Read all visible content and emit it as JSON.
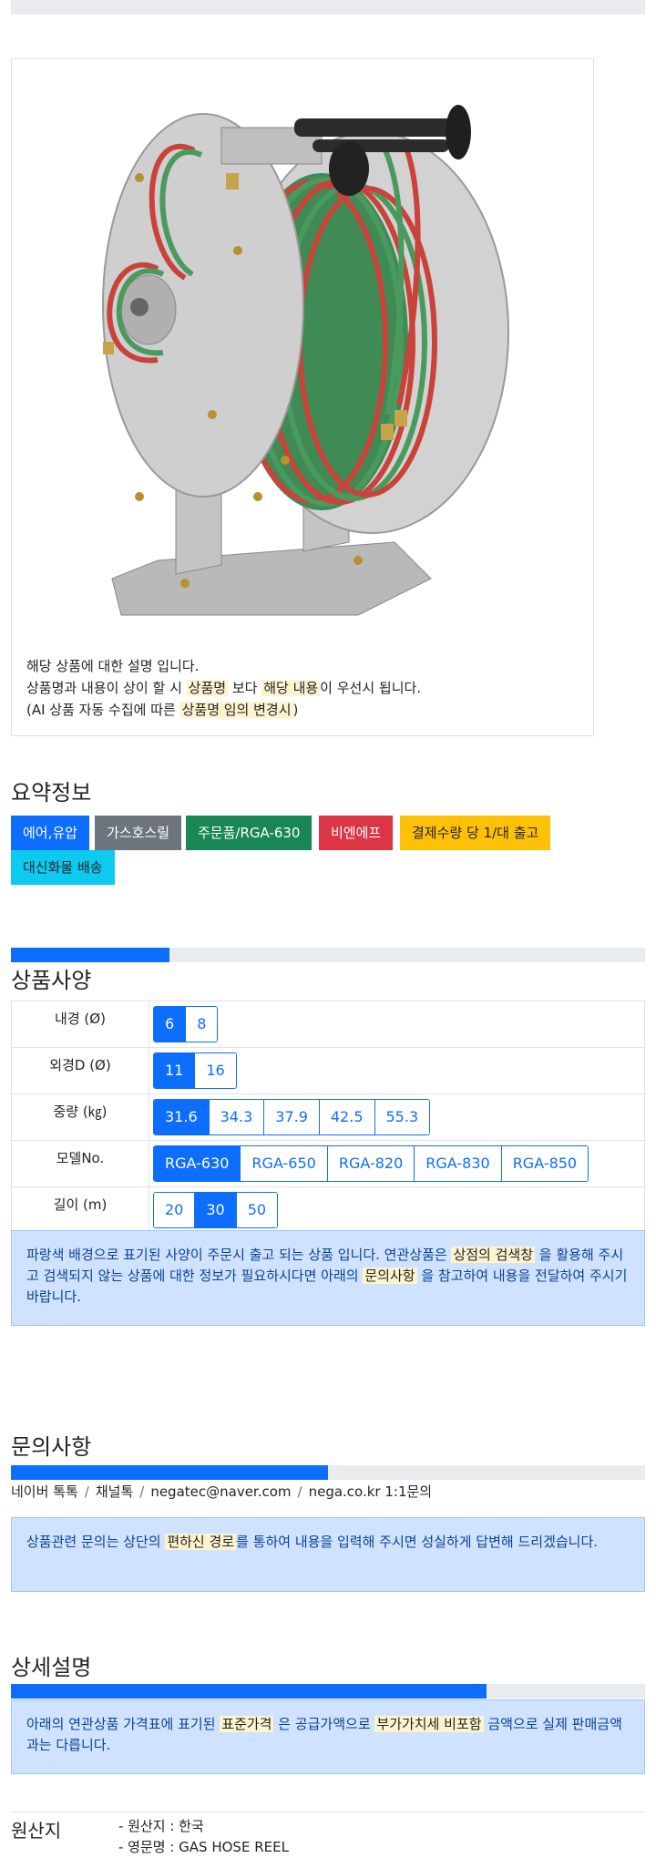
{
  "product": {
    "image_alt": "gas-hose-reel-photo",
    "desc_line1": "해당 상품에 대한 설명 입니다.",
    "desc_line2_a": "상품명과 내용이 상이 할 시 ",
    "desc_line2_hl1": "상품명",
    "desc_line2_b": " 보다 ",
    "desc_line2_hl2": "해당 내용",
    "desc_line2_c": "이 우선시 됩니다.",
    "desc_line3_a": "(AI 상품 자동 수집에 따른 ",
    "desc_line3_hl": "상품명 임의 변경시",
    "desc_line3_b": ")"
  },
  "summary": {
    "title": "요약정보",
    "badges": [
      {
        "label": "에어,유압",
        "color": "#0d6efd"
      },
      {
        "label": "가스호스릴",
        "color": "#6c757d"
      },
      {
        "label": "주문품/RGA-630",
        "color": "#198754"
      },
      {
        "label": "비엔에프",
        "color": "#dc3545"
      },
      {
        "label": "결제수량 당 1/대 출고",
        "color": "#ffc107"
      },
      {
        "label": "대신화물 배송",
        "color": "#0dcaf0"
      }
    ]
  },
  "spec": {
    "progress": 0.25,
    "title": "상품사양",
    "rows": [
      {
        "label": "내경 (Ø)",
        "options": [
          "6",
          "8"
        ],
        "selected": 0
      },
      {
        "label": "외경D (Ø)",
        "options": [
          "11",
          "16"
        ],
        "selected": 0
      },
      {
        "label": "중량 (㎏)",
        "options": [
          "31.6",
          "34.3",
          "37.9",
          "42.5",
          "55.3"
        ],
        "selected": 0
      },
      {
        "label": "모델No.",
        "options": [
          "RGA-630",
          "RGA-650",
          "RGA-820",
          "RGA-830",
          "RGA-850"
        ],
        "selected": 0
      },
      {
        "label": "길이 (m)",
        "options": [
          "20",
          "30",
          "50"
        ],
        "selected": 1
      }
    ],
    "notice_a": "파랑색 배경으로 표기된 사양이 주문시 출고 되는 상품 입니다. 연관상품은 ",
    "notice_hl1": "상점의 검색창",
    "notice_b": " 을 활용해 주시고 검색되지 않는 상품에 대한 정보가 필요하시다면 아래의 ",
    "notice_hl2": "문의사항",
    "notice_c": " 을 참고하여 내용을 전달하여 주시기 바랍니다."
  },
  "inquiry": {
    "title": "문의사항",
    "progress": 0.5,
    "contacts": [
      "네이버 톡톡",
      "채널톡",
      "negatec@naver.com",
      "nega.co.kr 1:1문의"
    ],
    "separator": "/",
    "notice_a": "상품관련 문의는 상단의 ",
    "notice_hl": "편하신 경로",
    "notice_b": "를 통하여 내용을 입력해 주시면 성실하게 답변해 드리겠습니다."
  },
  "detail": {
    "title": "상세설명",
    "progress": 0.75,
    "notice_a": "아래의 연관상품 가격표에 표기된 ",
    "notice_hl1": "표준가격",
    "notice_b": " 은 공급가액으로 ",
    "notice_hl2": "부가가치세 비포함",
    "notice_c": " 금액으로 실제 판매금액과는 다릅니다."
  },
  "origin": {
    "label": "원산지",
    "items": [
      "- 원산지 : 한국",
      "- 영문명 : GAS HOSE REEL"
    ]
  }
}
